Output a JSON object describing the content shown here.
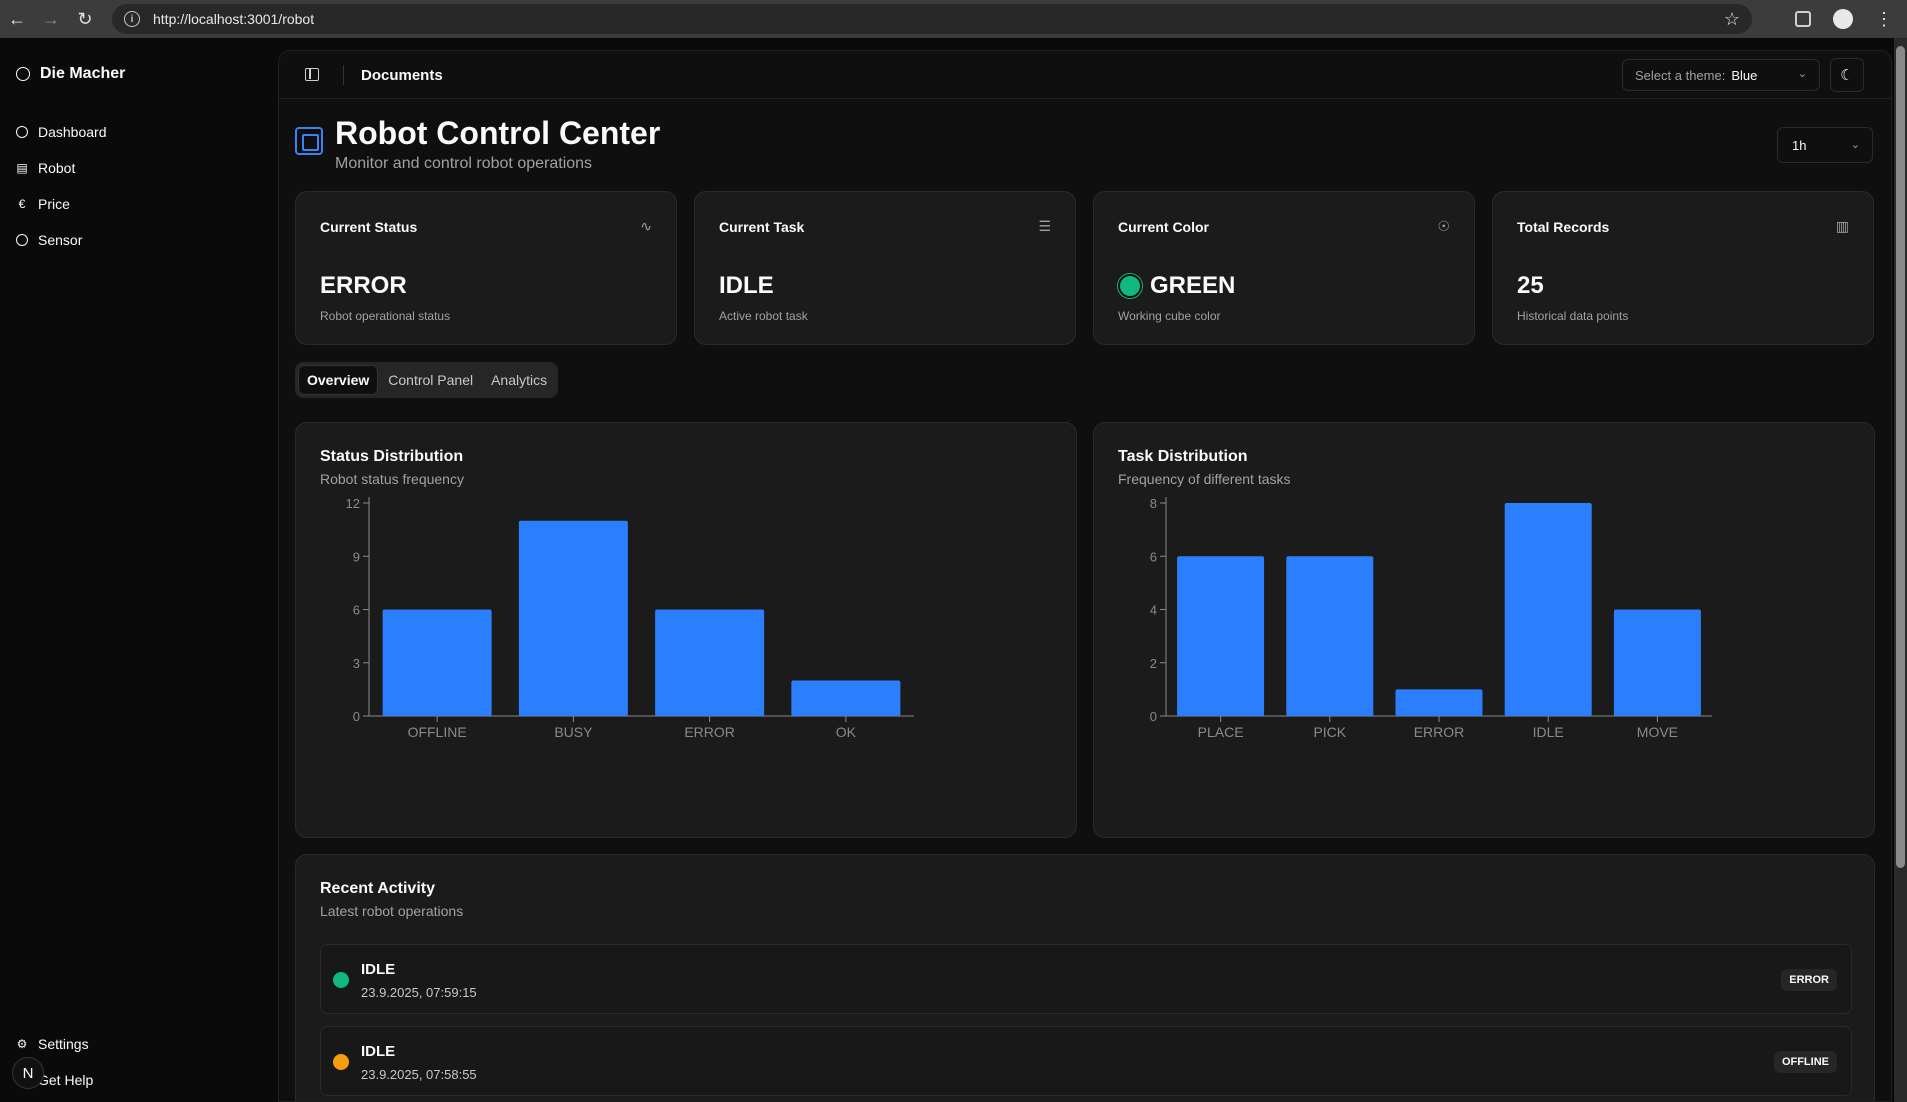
{
  "browser": {
    "url": "http://localhost:3001/robot"
  },
  "sidebar": {
    "brand": "Die Macher",
    "items": [
      {
        "label": "Dashboard",
        "icon": "gauge-icon"
      },
      {
        "label": "Robot",
        "icon": "robot-icon"
      },
      {
        "label": "Price",
        "icon": "euro-icon"
      },
      {
        "label": "Sensor",
        "icon": "sensor-icon"
      }
    ],
    "bottom_items": [
      {
        "label": "Settings",
        "icon": "gear-icon"
      },
      {
        "label": "Get Help",
        "icon": "help-icon"
      }
    ],
    "avatar_letter": "N"
  },
  "topbar": {
    "title": "Documents",
    "theme_label": "Select a theme:",
    "theme_value": "Blue"
  },
  "header": {
    "title": "Robot Control Center",
    "subtitle": "Monitor and control robot operations",
    "range_value": "1h"
  },
  "cards": [
    {
      "title": "Current Status",
      "value": "ERROR",
      "desc": "Robot operational status",
      "icon": "activity-icon"
    },
    {
      "title": "Current Task",
      "value": "IDLE",
      "desc": "Active robot task",
      "icon": "list-icon"
    },
    {
      "title": "Current Color",
      "value": "GREEN",
      "desc": "Working cube color",
      "icon": "palette-icon"
    },
    {
      "title": "Total Records",
      "value": "25",
      "desc": "Historical data points",
      "icon": "bar-chart-icon"
    }
  ],
  "tabs": [
    {
      "label": "Overview",
      "active": true
    },
    {
      "label": "Control Panel",
      "active": false
    },
    {
      "label": "Analytics",
      "active": false
    }
  ],
  "status_chart": {
    "title": "Status Distribution",
    "subtitle": "Robot status frequency"
  },
  "task_chart": {
    "title": "Task Distribution",
    "subtitle": "Frequency of different tasks"
  },
  "chart_data": [
    {
      "type": "bar",
      "title": "Status Distribution",
      "categories": [
        "OFFLINE",
        "BUSY",
        "ERROR",
        "OK"
      ],
      "values": [
        6,
        11,
        6,
        2
      ],
      "ylim": [
        0,
        12
      ],
      "yticks": [
        0,
        3,
        6,
        9,
        12
      ],
      "color": "#2b7fff"
    },
    {
      "type": "bar",
      "title": "Task Distribution",
      "categories": [
        "PLACE",
        "PICK",
        "ERROR",
        "IDLE",
        "MOVE"
      ],
      "values": [
        6,
        6,
        1,
        8,
        4
      ],
      "ylim": [
        0,
        8
      ],
      "yticks": [
        0,
        2,
        4,
        6,
        8
      ],
      "color": "#2b7fff"
    }
  ],
  "activity": {
    "title": "Recent Activity",
    "subtitle": "Latest robot operations",
    "rows": [
      {
        "task": "IDLE",
        "time": "23.9.2025, 07:59:15",
        "status": "ERROR",
        "dot_color": "#10b981"
      },
      {
        "task": "IDLE",
        "time": "23.9.2025, 07:58:55",
        "status": "OFFLINE",
        "dot_color": "#f59e0b"
      }
    ]
  }
}
